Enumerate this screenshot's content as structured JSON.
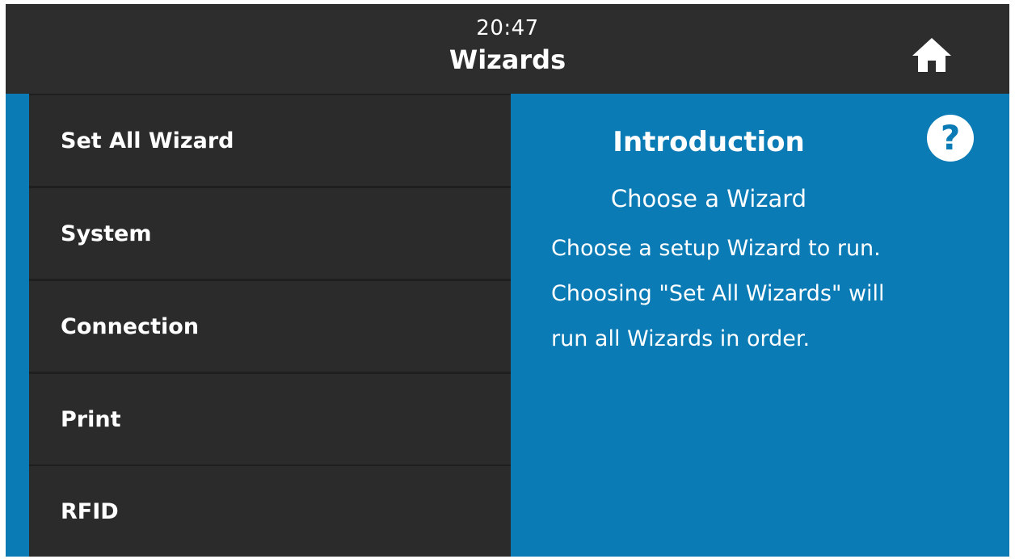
{
  "header": {
    "time": "20:47",
    "title": "Wizards",
    "home_icon": "home-icon"
  },
  "menu": {
    "items": [
      {
        "label": "Set All Wizard"
      },
      {
        "label": "System"
      },
      {
        "label": "Connection"
      },
      {
        "label": "Print"
      },
      {
        "label": "RFID"
      }
    ]
  },
  "detail": {
    "heading": "Introduction",
    "help_label": "?",
    "subheading": "Choose a Wizard",
    "body": "Choose a setup Wizard to run.\nChoosing \"Set All Wizards\" will\nrun all Wizards in order."
  },
  "colors": {
    "header_bg": "#2d2d2d",
    "menu_bg": "#2b2b2b",
    "accent_blue": "#0b7bb5",
    "text": "#ffffff"
  }
}
